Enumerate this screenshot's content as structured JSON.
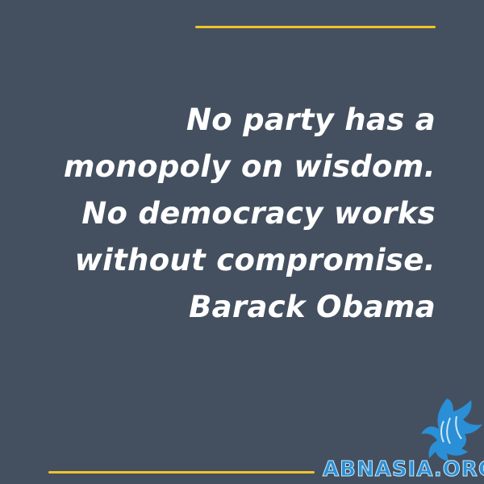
{
  "quote": {
    "lines": [
      "No party has a",
      "monopoly on wisdom.",
      "No democracy works",
      "without compromise.",
      "Barack Obama"
    ]
  },
  "branding": {
    "site": "ABNASIA.ORG",
    "logo_icon": "winged-lion-icon",
    "logo_color": "#2a8fd6"
  },
  "colors": {
    "background": "#44505f",
    "accent_rule": "#f2c32a",
    "text": "#ffffff"
  }
}
